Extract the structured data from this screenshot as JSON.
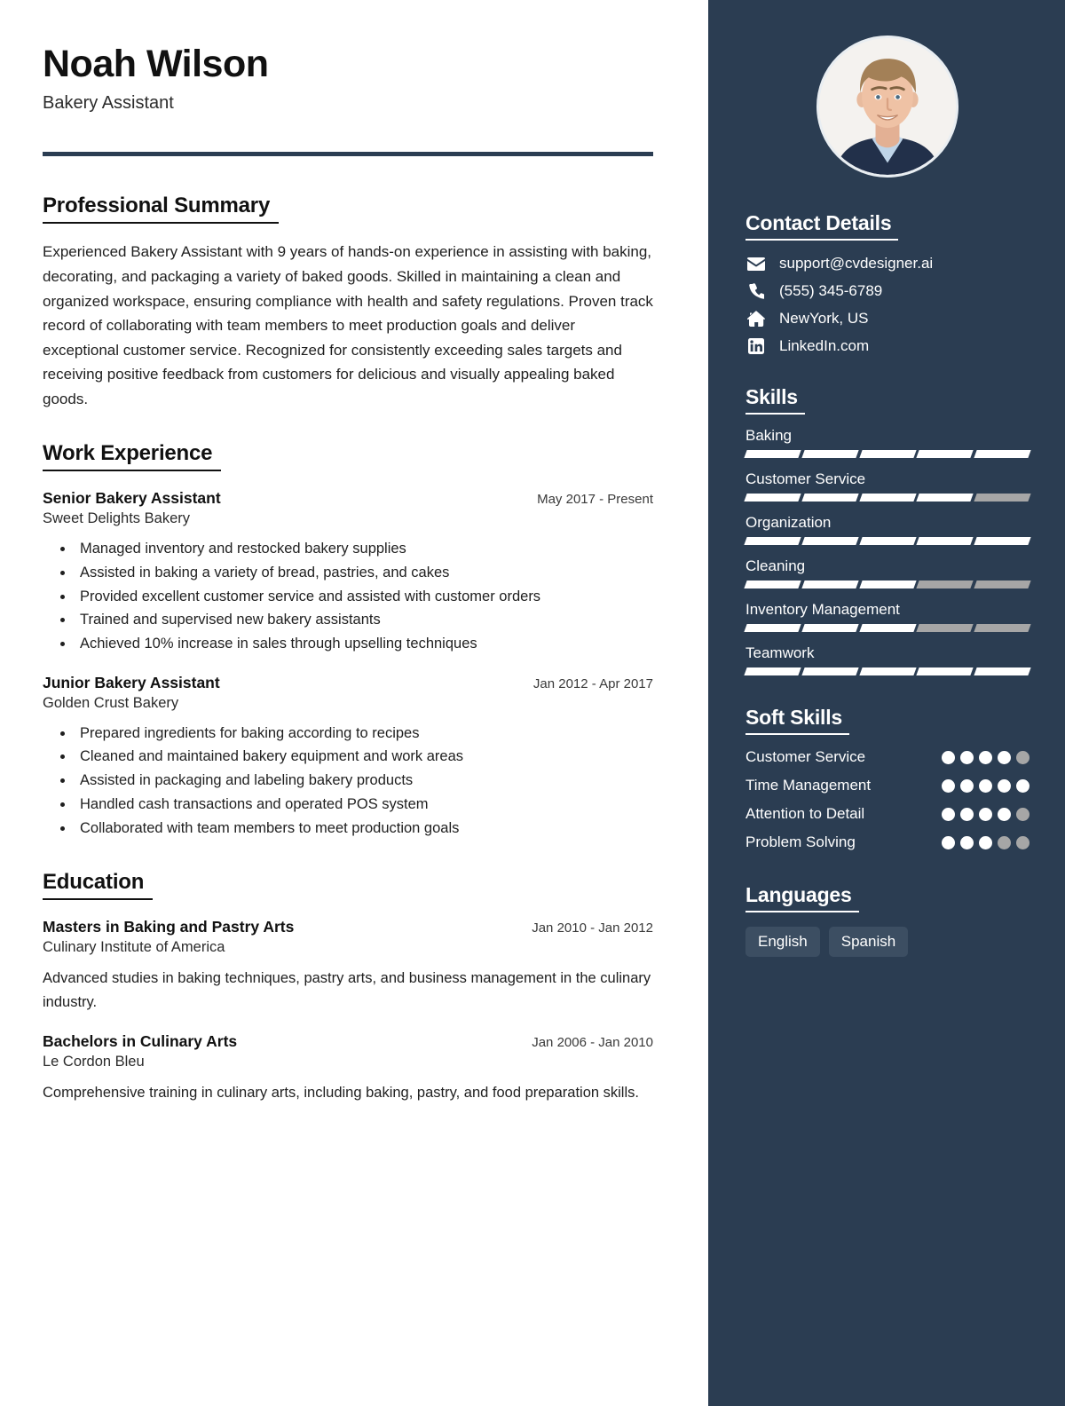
{
  "colors": {
    "sidebar_bg": "#2b3d52",
    "accent_rule": "#2b3d52",
    "skill_filled": "#ffffff",
    "skill_empty": "#a6a6a6",
    "pill_bg": "#3c4e62"
  },
  "header": {
    "name": "Noah Wilson",
    "job_title": "Bakery Assistant"
  },
  "summary": {
    "heading": "Professional Summary",
    "text": "Experienced Bakery Assistant with 9 years of hands-on experience in assisting with baking, decorating, and packaging a variety of baked goods. Skilled in maintaining a clean and organized workspace, ensuring compliance with health and safety regulations. Proven track record of collaborating with team members to meet production goals and deliver exceptional customer service. Recognized for consistently exceeding sales targets and receiving positive feedback from customers for delicious and visually appealing baked goods."
  },
  "work_experience": {
    "heading": "Work Experience",
    "entries": [
      {
        "title": "Senior Bakery Assistant",
        "date": "May 2017 - Present",
        "organization": "Sweet Delights Bakery",
        "bullets": [
          "Managed inventory and restocked bakery supplies",
          "Assisted in baking a variety of bread, pastries, and cakes",
          "Provided excellent customer service and assisted with customer orders",
          "Trained and supervised new bakery assistants",
          "Achieved 10% increase in sales through upselling techniques"
        ]
      },
      {
        "title": "Junior Bakery Assistant",
        "date": "Jan 2012 - Apr 2017",
        "organization": "Golden Crust Bakery",
        "bullets": [
          "Prepared ingredients for baking according to recipes",
          "Cleaned and maintained bakery equipment and work areas",
          "Assisted in packaging and labeling bakery products",
          "Handled cash transactions and operated POS system",
          "Collaborated with team members to meet production goals"
        ]
      }
    ]
  },
  "education": {
    "heading": "Education",
    "entries": [
      {
        "title": "Masters in Baking and Pastry Arts",
        "date": "Jan 2010 - Jan 2012",
        "organization": "Culinary Institute of America",
        "description": "Advanced studies in baking techniques, pastry arts, and business management in the culinary industry."
      },
      {
        "title": "Bachelors in Culinary Arts",
        "date": "Jan 2006 - Jan 2010",
        "organization": "Le Cordon Bleu",
        "description": "Comprehensive training in culinary arts, including baking, pastry, and food preparation skills."
      }
    ]
  },
  "photo": {
    "alt": "profile-photo"
  },
  "contact": {
    "heading": "Contact Details",
    "items": [
      {
        "icon": "envelope-icon",
        "value": "support@cvdesigner.ai"
      },
      {
        "icon": "phone-icon",
        "value": "(555) 345-6789"
      },
      {
        "icon": "home-icon",
        "value": "NewYork, US"
      },
      {
        "icon": "linkedin-icon",
        "value": "LinkedIn.com"
      }
    ]
  },
  "skills": {
    "heading": "Skills",
    "max_level": 5,
    "items": [
      {
        "name": "Baking",
        "level": 5
      },
      {
        "name": "Customer Service",
        "level": 4
      },
      {
        "name": "Organization",
        "level": 5
      },
      {
        "name": "Cleaning",
        "level": 3
      },
      {
        "name": "Inventory Management",
        "level": 3
      },
      {
        "name": "Teamwork",
        "level": 5
      }
    ]
  },
  "soft_skills": {
    "heading": "Soft Skills",
    "max_level": 5,
    "items": [
      {
        "name": "Customer Service",
        "level": 4
      },
      {
        "name": "Time Management",
        "level": 5
      },
      {
        "name": "Attention to Detail",
        "level": 4
      },
      {
        "name": "Problem Solving",
        "level": 3
      }
    ]
  },
  "languages": {
    "heading": "Languages",
    "items": [
      "English",
      "Spanish"
    ]
  }
}
